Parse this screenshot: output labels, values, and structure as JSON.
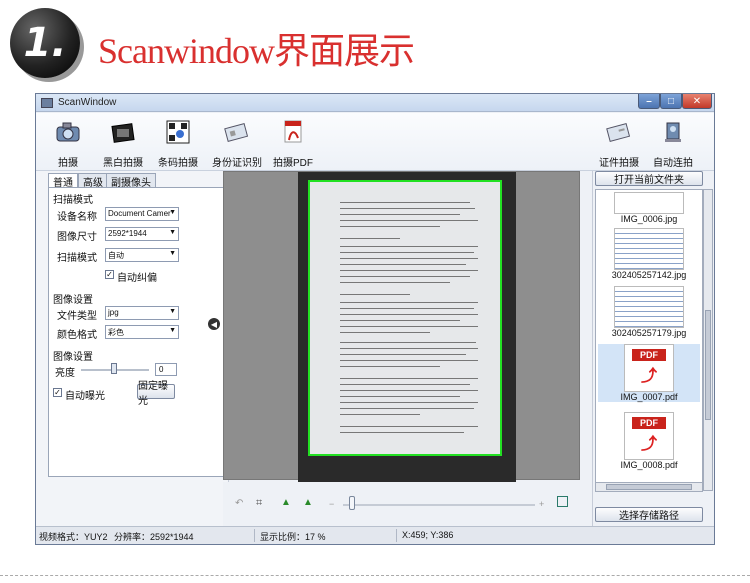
{
  "banner": {
    "number": "1.",
    "title": "Scanwindow界面展示"
  },
  "window": {
    "title": "ScanWindow",
    "min": "–",
    "max": "□",
    "close": "✕"
  },
  "toolbar": {
    "left": [
      {
        "label": "拍摄",
        "icon": "camera-icon"
      },
      {
        "label": "黑白拍摄",
        "icon": "bw-camera-icon"
      },
      {
        "label": "条码拍摄",
        "icon": "barcode-icon"
      },
      {
        "label": "身份证识别",
        "icon": "id-card-icon"
      },
      {
        "label": "拍摄PDF",
        "icon": "pdf-icon"
      }
    ],
    "right": [
      {
        "label": "证件拍摄",
        "icon": "certificate-icon"
      },
      {
        "label": "自动连拍",
        "icon": "auto-shoot-icon"
      }
    ]
  },
  "tabs": [
    "普通",
    "高级",
    "副摄像头"
  ],
  "scan_mode": {
    "group": "扫描模式",
    "device_label": "设备名称",
    "device_value": "Document Camer",
    "size_label": "图像尺寸",
    "size_value": "2592*1944",
    "mode_label": "扫描模式",
    "mode_value": "自动",
    "auto_crop_label": "自动纠偏",
    "auto_crop_checked": true
  },
  "image_settings": {
    "group": "图像设置",
    "type_label": "文件类型",
    "type_value": "jpg",
    "color_label": "颜色格式",
    "color_value": "彩色"
  },
  "image_adjust": {
    "group": "图像设置",
    "brightness_label": "亮度",
    "brightness_value": "0",
    "auto_exposure_label": "自动曝光",
    "auto_exposure_checked": true,
    "fixed_exposure_label": "固定曝光"
  },
  "right_panel": {
    "open_folder": "打开当前文件夹",
    "choose_path": "选择存储路径",
    "thumbs": [
      "IMG_0006.jpg",
      "302405257142.jpg",
      "302405257179.jpg",
      "IMG_0007.pdf",
      "IMG_0008.pdf"
    ],
    "pdf_tag": "PDF"
  },
  "status": {
    "format": "视频格式：YUY2",
    "resolution": "分辨率：2592*1944",
    "ratio": "显示比例：17 %",
    "coords": "X:459; Y:386"
  },
  "colors": {
    "accent_title": "#d9302f",
    "crop_frame": "#22e022",
    "pdf_red": "#c9231b"
  }
}
